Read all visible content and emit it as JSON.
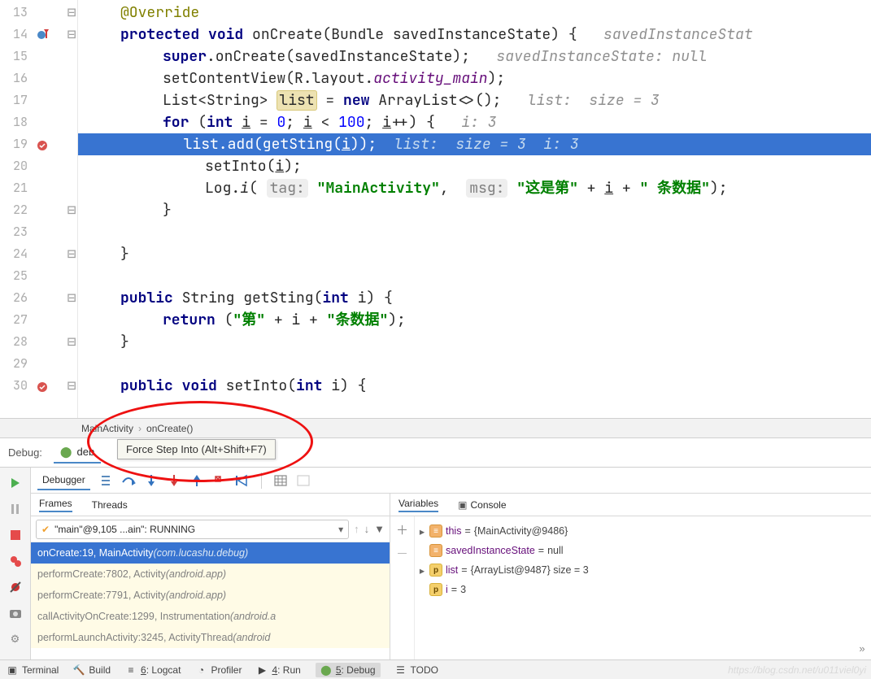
{
  "editor": {
    "lines": [
      {
        "n": 13,
        "kind": "ann",
        "text": "@Override",
        "indent": 52,
        "fold": "⊖"
      },
      {
        "n": 14,
        "kind": "sig",
        "indent": 52,
        "fold": "⊖",
        "bp": "blue",
        "tokens": [
          "protected",
          "void",
          "onCreate(Bundle savedInstanceState) {"
        ],
        "hint": "savedInstanceStat"
      },
      {
        "n": 15,
        "indent": 104,
        "tokens_html": "<span class='kw'>super</span>.onCreate(savedInstanceState);",
        "hint": "savedInstanceState: null"
      },
      {
        "n": 16,
        "indent": 104,
        "tokens_html": "setContentView(R.layout.<span class='ital'>activity_main</span>);"
      },
      {
        "n": 17,
        "indent": 104,
        "tokens_html": "List&lt;String&gt; <span class='usage'>list</span> = <span class='kw'>new</span> ArrayList&lt;&gt;();",
        "hint": "list:  size = 3"
      },
      {
        "n": 18,
        "indent": 104,
        "tokens_html": "<span class='kw'>for</span> (<span class='kw'>int</span> <span class='ul'>i</span> = <span class='num'>0</span>; <span class='ul'>i</span> &lt; <span class='num'>100</span>; <span class='ul'>i</span>++) {",
        "hint": "i: 3"
      },
      {
        "n": 19,
        "indent": 0,
        "bp": "red",
        "highlight": true,
        "code_text": "            list.add(getSting(i));",
        "hint_text": "  list:  size = 3  i: 3"
      },
      {
        "n": 20,
        "indent": 156,
        "tokens_html": "setInto(<span class='ul'>i</span>);"
      },
      {
        "n": 21,
        "indent": 156,
        "tokens_html": "Log.<span style='font-style:italic'>i</span>( <span class='pill'>tag:</span> <span class='str'>\"MainActivity\"</span>,  <span class='pill'>msg:</span> <span class='str'>\"这是第\"</span> + <span class='ul'>i</span> + <span class='str'>\" 条数据\"</span>);"
      },
      {
        "n": 22,
        "indent": 104,
        "tokens_html": "}",
        "fold": "⊖"
      },
      {
        "n": 23,
        "indent": 0,
        "tokens_html": ""
      },
      {
        "n": 24,
        "indent": 52,
        "tokens_html": "}",
        "fold": "⊖"
      },
      {
        "n": 25,
        "indent": 0,
        "tokens_html": ""
      },
      {
        "n": 26,
        "indent": 52,
        "fold": "⊖",
        "tokens_html": "<span class='kw'>public</span> String getSting(<span class='kw'>int</span> i) {"
      },
      {
        "n": 27,
        "indent": 104,
        "tokens_html": "<span class='kw'>return</span> (<span class='str'>\"第\"</span> + i + <span class='str'>\"条数据\"</span>);"
      },
      {
        "n": 28,
        "indent": 52,
        "tokens_html": "}",
        "fold": "⊖"
      },
      {
        "n": 29,
        "indent": 0,
        "tokens_html": ""
      },
      {
        "n": 30,
        "indent": 52,
        "fold": "⊖",
        "bp": "red-u",
        "tokens_html": "<span class='kw'>public</span> <span class='kw'>void</span> setInto(<span class='kw'>int</span> i) {"
      }
    ]
  },
  "breadcrumb": {
    "a": "MainActivity",
    "b": "onCreate()"
  },
  "debug_label": "Debug:",
  "debug_tab": "deb",
  "tooltip": "Force Step Into (Alt+Shift+F7)",
  "debugger_tab": "Debugger",
  "frames_tab": "Frames",
  "threads_tab": "Threads",
  "variables_tab": "Variables",
  "console_tab": "Console",
  "thread_combo": "\"main\"@9,105 ...ain\": RUNNING",
  "frames": [
    {
      "sel": true,
      "main": "onCreate:19, MainActivity ",
      "pkg": "(com.lucashu.debug)"
    },
    {
      "lib": true,
      "main": "performCreate:7802, Activity ",
      "pkg": "(android.app)"
    },
    {
      "lib": true,
      "main": "performCreate:7791, Activity ",
      "pkg": "(android.app)"
    },
    {
      "lib": true,
      "main": "callActivityOnCreate:1299, Instrumentation ",
      "pkg": "(android.a"
    },
    {
      "lib": true,
      "main": "performLaunchActivity:3245, ActivityThread ",
      "pkg": "(android"
    }
  ],
  "vars": [
    {
      "exp": "▸",
      "badge": "obj",
      "badge_txt": "≡",
      "name": "this",
      "val": "{MainActivity@9486}"
    },
    {
      "exp": "",
      "badge": "obj",
      "badge_txt": "≡",
      "name": "savedInstanceState",
      "val": "null"
    },
    {
      "exp": "▸",
      "badge": "prim",
      "badge_txt": "p",
      "name": "list",
      "val": "{ArrayList@9487}  size = 3"
    },
    {
      "exp": "",
      "badge": "prim",
      "badge_txt": "p",
      "name": "i",
      "val": "3"
    }
  ],
  "statusbar": {
    "terminal": "Terminal",
    "build": "Build",
    "logcat": "6: Logcat",
    "profiler": "Profiler",
    "run": "4: Run",
    "debug": "5: Debug",
    "todo": "TODO"
  },
  "watermark": "https://blog.csdn.net/u011viel0yi"
}
